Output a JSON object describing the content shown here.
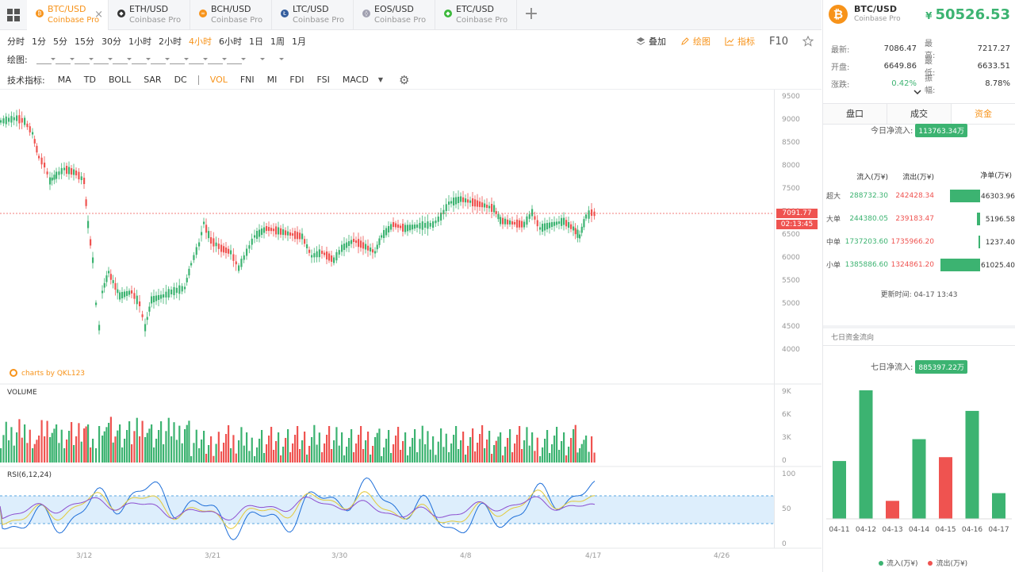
{
  "tabs": [
    {
      "name": "BTC/USD",
      "exchange": "Coinbase Pro",
      "active": true,
      "icon": "bitcoin-icon",
      "color": "#f7931a",
      "glyph": "₿"
    },
    {
      "name": "ETH/USD",
      "exchange": "Coinbase Pro",
      "active": false,
      "icon": "ethereum-icon",
      "color": "#333333",
      "glyph": "◆"
    },
    {
      "name": "BCH/USD",
      "exchange": "Coinbase Pro",
      "active": false,
      "icon": "bitcoin-cash-icon",
      "color": "#f7931a",
      "glyph": "∞"
    },
    {
      "name": "LTC/USD",
      "exchange": "Coinbase Pro",
      "active": false,
      "icon": "litecoin-icon",
      "color": "#345d9d",
      "glyph": "Ł"
    },
    {
      "name": "EOS/USD",
      "exchange": "Coinbase Pro",
      "active": false,
      "icon": "eos-icon",
      "color": "#a0a0b0",
      "glyph": "◊"
    },
    {
      "name": "ETC/USD",
      "exchange": "Coinbase Pro",
      "active": false,
      "icon": "ethereum-classic-icon",
      "color": "#3ab83a",
      "glyph": "◆"
    }
  ],
  "timeframes": [
    "分时",
    "1分",
    "5分",
    "15分",
    "30分",
    "1小时",
    "2小时",
    "4小时",
    "6小时",
    "1日",
    "1周",
    "1月"
  ],
  "active_timeframe": "4小时",
  "top_tools": {
    "overlay": "叠加",
    "draw": "绘图",
    "indicator": "指标",
    "f10": "F10"
  },
  "draw_label": "绘图:",
  "indicators_label": "技术指标:",
  "indicators_main": [
    "MA",
    "TD",
    "BOLL",
    "SAR",
    "DC"
  ],
  "indicators_sub": [
    "VOL",
    "FNI",
    "MI",
    "FDI",
    "FSI",
    "MACD"
  ],
  "active_indicator": "VOL",
  "chart": {
    "price_axis": [
      "9500",
      "9000",
      "8500",
      "8000",
      "7500",
      "7000",
      "6500",
      "6000",
      "5500",
      "5000",
      "4500",
      "4000"
    ],
    "current_price": "7091.77",
    "countdown": "02:13:45",
    "watermark": "charts by QKL123",
    "volume_title": "VOLUME",
    "volume_axis": [
      "9K",
      "6K",
      "3K",
      "0"
    ],
    "rsi_title": "RSI(6,12,24)",
    "rsi_axis": [
      "100",
      "50",
      "0"
    ],
    "dates": [
      "3/12",
      "3/21",
      "3/30",
      "4/8",
      "4/17",
      "4/26"
    ],
    "colors": {
      "up": "#3cb371",
      "down": "#ef5350"
    }
  },
  "panel": {
    "pair": "BTC/USD",
    "exchange": "Coinbase Pro",
    "currency_symbol": "¥",
    "price": "50526.53",
    "stats": [
      {
        "k": "最新:",
        "v": "7086.47",
        "k2": "最高:",
        "v2": "7217.27"
      },
      {
        "k": "开盘:",
        "v": "6649.86",
        "k2": "最低:",
        "v2": "6633.51"
      },
      {
        "k": "涨跌:",
        "v": "0.42%",
        "k2": "振幅:",
        "v2": "8.78%"
      }
    ],
    "tabs": [
      "盘口",
      "成交",
      "资金"
    ],
    "active_tab": "资金",
    "today_label": "今日净流入:",
    "today_value": "113763.34万",
    "table_head": [
      "流入(万¥)",
      "流出(万¥)",
      "净单(万¥)"
    ],
    "rows": [
      {
        "label": "超大",
        "in": "288732.30",
        "out": "242428.34",
        "net": "46303.96",
        "ratio": 0.76
      },
      {
        "label": "大单",
        "in": "244380.05",
        "out": "239183.47",
        "net": "5196.58",
        "ratio": 0.085
      },
      {
        "label": "中单",
        "in": "1737203.60",
        "out": "1735966.20",
        "net": "1237.40",
        "ratio": 0.02
      },
      {
        "label": "小单",
        "in": "1385886.60",
        "out": "1324861.20",
        "net": "61025.40",
        "ratio": 1.0
      }
    ],
    "update_label": "更新时间:",
    "update_time": "04-17 13:43",
    "seven_title": "七日资金流向",
    "seven_label": "七日净流入:",
    "seven_value": "885397.22万",
    "seven_days": [
      {
        "date": "04-11",
        "value": 0.45,
        "dir": "in"
      },
      {
        "date": "04-12",
        "value": 1.0,
        "dir": "in"
      },
      {
        "date": "04-13",
        "value": 0.14,
        "dir": "out"
      },
      {
        "date": "04-14",
        "value": 0.62,
        "dir": "in"
      },
      {
        "date": "04-15",
        "value": 0.48,
        "dir": "out"
      },
      {
        "date": "04-16",
        "value": 0.84,
        "dir": "in"
      },
      {
        "date": "04-17",
        "value": 0.2,
        "dir": "in"
      }
    ],
    "legend_in": "流入(万¥)",
    "legend_out": "流出(万¥)"
  }
}
